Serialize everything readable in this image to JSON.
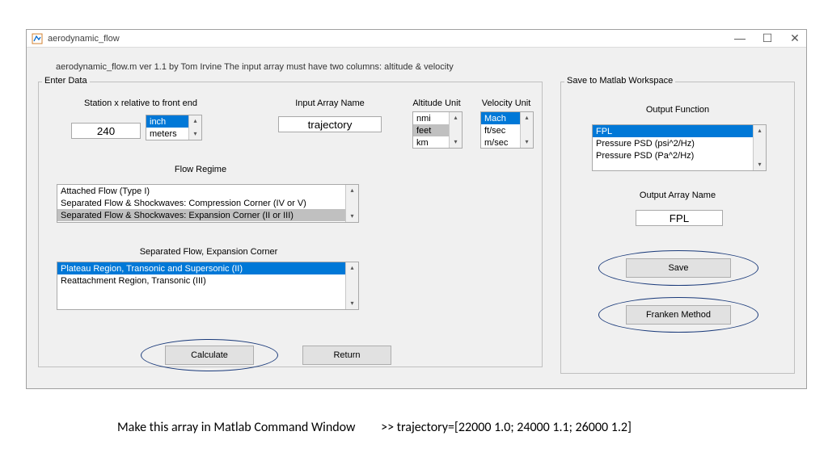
{
  "window": {
    "title": "aerodynamic_flow"
  },
  "info_line": "aerodynamic_flow.m   ver 1.1   by Tom Irvine   The input array must have two columns:   altitude & velocity",
  "enter_data": {
    "legend": "Enter Data",
    "station_label": "Station x relative to front end",
    "station_value": "240",
    "unit_opts": [
      "inch",
      "meters"
    ],
    "input_array_label": "Input Array Name",
    "input_array_value": "trajectory",
    "altitude_label": "Altitude Unit",
    "altitude_opts": [
      "nmi",
      "feet",
      "km"
    ],
    "velocity_label": "Velocity Unit",
    "velocity_opts": [
      "Mach",
      "ft/sec",
      "m/sec"
    ],
    "flow_regime_label": "Flow Regime",
    "flow_regime_opts": [
      "Attached Flow (Type I)",
      "Separated Flow & Shockwaves: Compression Corner (IV or V)",
      "Separated Flow & Shockwaves: Expansion Corner   (II or III)"
    ],
    "sep_flow_label": "Separated Flow, Expansion Corner",
    "sep_flow_opts": [
      "Plateau Region, Transonic and Supersonic (II)",
      "Reattachment Region, Transonic (III)"
    ],
    "calculate_btn": "Calculate",
    "return_btn": "Return"
  },
  "save_panel": {
    "legend": "Save to Matlab Workspace",
    "output_function_label": "Output Function",
    "output_function_opts": [
      "FPL",
      "Pressure PSD (psi^2/Hz)",
      "Pressure PSD (Pa^2/Hz)"
    ],
    "output_array_label": "Output Array Name",
    "output_array_value": "FPL",
    "save_btn": "Save",
    "franken_btn": "Franken Method"
  },
  "caption": {
    "text": "Make this array in Matlab  Command Window",
    "code": ">> trajectory=[22000 1.0; 24000 1.1; 26000 1.2]"
  }
}
